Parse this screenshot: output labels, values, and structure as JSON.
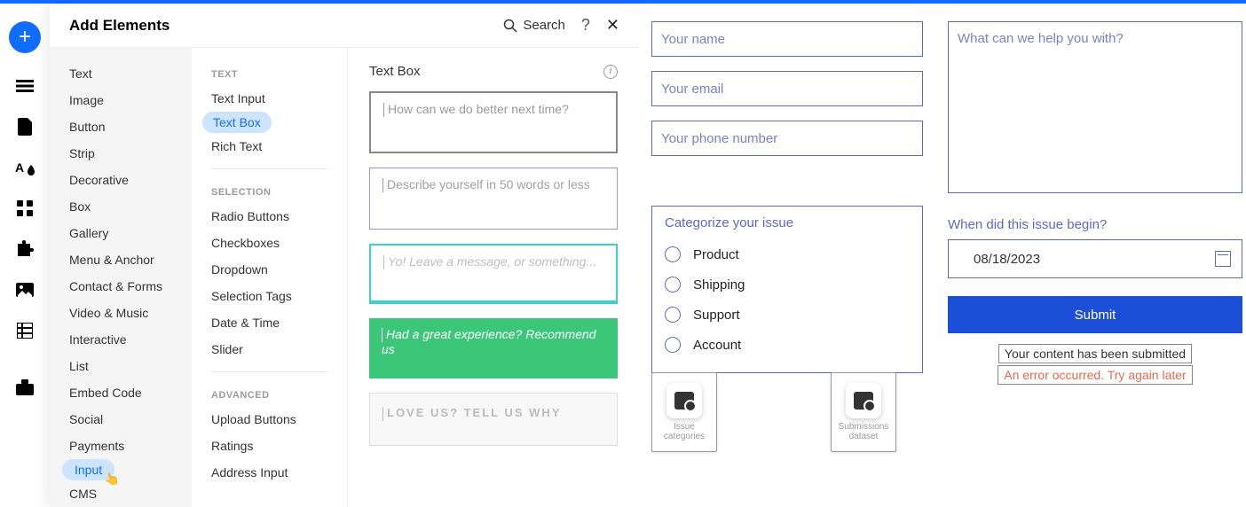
{
  "top_accent": "#116dff",
  "rail": {
    "add_tooltip": "Add"
  },
  "panel": {
    "title": "Add Elements",
    "search_label": "Search",
    "col1": [
      "Text",
      "Image",
      "Button",
      "Strip",
      "Decorative",
      "Box",
      "Gallery",
      "Menu & Anchor",
      "Contact & Forms",
      "Video & Music",
      "Interactive",
      "List",
      "Embed Code",
      "Social",
      "Payments",
      "Input",
      "CMS"
    ],
    "col1_selected": "Input",
    "col2": {
      "text_header": "TEXT",
      "text_items": [
        "Text Input",
        "Text Box",
        "Rich Text"
      ],
      "text_selected": "Text Box",
      "selection_header": "SELECTION",
      "selection_items": [
        "Radio Buttons",
        "Checkboxes",
        "Dropdown",
        "Selection Tags",
        "Date & Time",
        "Slider"
      ],
      "advanced_header": "ADVANCED",
      "advanced_items": [
        "Upload Buttons",
        "Ratings",
        "Address Input"
      ]
    },
    "col3": {
      "title": "Text Box",
      "previews": {
        "p1": "How can we do better next time?",
        "p2": "Describe yourself in 50 words or less",
        "p3": "Yo! Leave a message, or something...",
        "p4": "Had a great experience? Recommend us",
        "p5": "LOVE US? TELL US WHY"
      }
    }
  },
  "form": {
    "name_ph": "Your name",
    "email_ph": "Your email",
    "phone_ph": "Your phone number",
    "help_ph": "What can we help you with?",
    "categorize_title": "Categorize your issue",
    "radios": [
      "Product",
      "Shipping",
      "Support",
      "Account"
    ],
    "date_label": "When did this issue begin?",
    "date_value": "08/18/2023",
    "submit_label": "Submit",
    "success_msg": "Your content has been submitted",
    "error_msg": "An error occurred. Try again later",
    "ds1_label_a": "Issue",
    "ds1_label_b": "categories",
    "ds2_label_a": "Submissions",
    "ds2_label_b": "dataset"
  }
}
